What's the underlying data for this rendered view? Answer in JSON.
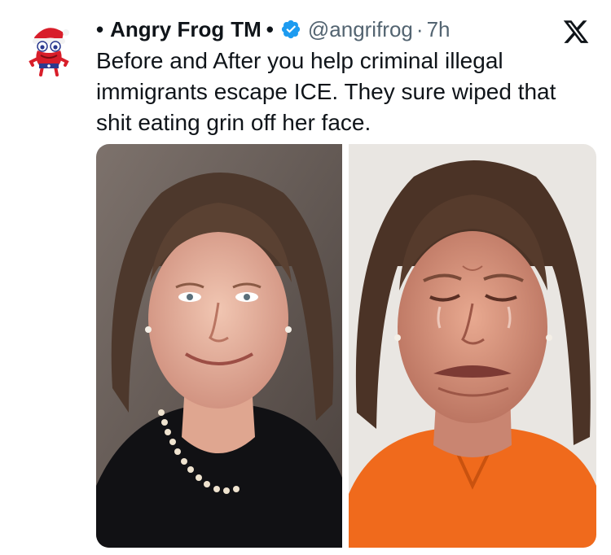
{
  "author": {
    "name": "Angry Frog",
    "trademark": "TM",
    "handle": "@angrifrog",
    "time": "7h",
    "verified": true,
    "avatar_icon": "red-frog-santa-hat-icon"
  },
  "separators": {
    "bullet": "•",
    "middot": "·"
  },
  "tweet": {
    "text_lines": [
      "Before and After you help criminal illegal",
      "immigrants escape ICE. They sure wiped that",
      "shit eating grin off her face."
    ]
  },
  "media": {
    "images": [
      {
        "description_icon": "smiling-woman-photo"
      },
      {
        "description_icon": "crying-woman-mugshot-photo"
      }
    ]
  },
  "icons": {
    "platform": "x-logo-icon",
    "verified": "verified-badge-icon"
  },
  "colors": {
    "text": "#0f1419",
    "secondary": "#536471",
    "verified_blue": "#1d9bf0",
    "orange_jumpsuit": "#f06a1c"
  }
}
